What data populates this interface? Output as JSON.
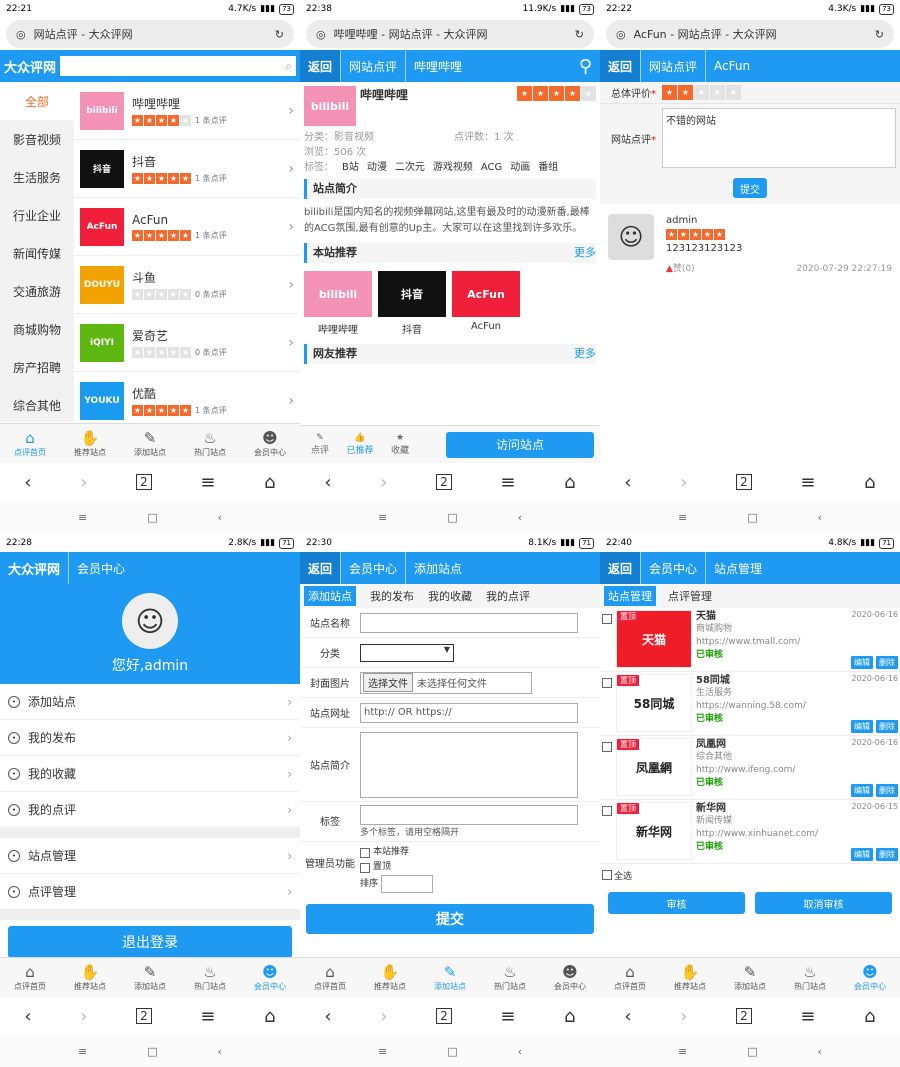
{
  "colors": {
    "blue": "#1e9af2",
    "orange": "#f56a2c",
    "green": "#18a000"
  },
  "tabs": [
    "点评首页",
    "推荐站点",
    "添加站点",
    "热门站点",
    "会员中心"
  ],
  "tab_icons": [
    "home-icon",
    "thumb-icon",
    "edit-icon",
    "flame-icon",
    "user-icon"
  ],
  "s1": {
    "time": "22:21",
    "net": "4.7K/s",
    "bat": "73",
    "url": "网站点评 - 大众评网",
    "brand": "大众评网",
    "cats": [
      "全部",
      "影音视频",
      "生活服务",
      "行业企业",
      "新闻传媒",
      "交通旅游",
      "商城购物",
      "房产招聘",
      "综合其他"
    ],
    "sites": [
      {
        "name": "哔哩哔哩",
        "rating": 4,
        "reviews": "1 条点评",
        "logo": "bilibili",
        "bg": "#f492b5"
      },
      {
        "name": "抖音",
        "rating": 5,
        "reviews": "1 条点评",
        "logo": "抖音",
        "bg": "#111111"
      },
      {
        "name": "AcFun",
        "rating": 5,
        "reviews": "1 条点评",
        "logo": "AcFun",
        "bg": "#f0203a"
      },
      {
        "name": "斗鱼",
        "rating": 0,
        "reviews": "0 条点评",
        "logo": "DOUYU",
        "bg": "#f2a300"
      },
      {
        "name": "爱奇艺",
        "rating": 0,
        "reviews": "0 条点评",
        "logo": "iQIYI",
        "bg": "#5fb812"
      },
      {
        "name": "优酷",
        "rating": 5,
        "reviews": "1 条点评",
        "logo": "YOUKU",
        "bg": "#1a9bf0"
      }
    ]
  },
  "s2": {
    "time": "22:38",
    "net": "11.9K/s",
    "bat": "73",
    "url": "哔哩哔哩 - 网站点评 - 大众评网",
    "back": "返回",
    "crumb1": "网站点评",
    "crumb2": "哔哩哔哩",
    "title": "哔哩哔哩",
    "rating": 4,
    "logo": "bilibili",
    "cat": "分类：影音视频",
    "count": "点评数：1 次",
    "views": "浏览：506 次",
    "tags_label": "标签：",
    "tags": [
      "B站",
      "动漫",
      "二次元",
      "游戏视频",
      "ACG",
      "动画",
      "番组"
    ],
    "intro_title": "站点简介",
    "intro": "bilibili是国内知名的视频弹幕网站,这里有最及时的动漫新番,最棒的ACG氛围,最有创意的Up主。大家可以在这里找到许多欢乐。",
    "rec_title": "本站推荐",
    "more": "更多",
    "recs": [
      {
        "name": "哔哩哔哩",
        "logo": "bilibili",
        "bg": "#f492b5"
      },
      {
        "name": "抖音",
        "logo": "抖音",
        "bg": "#111111"
      },
      {
        "name": "AcFun",
        "logo": "AcFun",
        "bg": "#f0203a"
      }
    ],
    "friend_title": "网友推荐",
    "actions": [
      "点评",
      "已推荐",
      "收藏"
    ],
    "visit": "访问站点"
  },
  "s3": {
    "time": "22:22",
    "net": "4.3K/s",
    "bat": "73",
    "url": "AcFun - 网站点评 - 大众评网",
    "back": "返回",
    "crumb1": "网站点评",
    "crumb2": "AcFun",
    "overall_label": "总体评价",
    "overall": 2,
    "review_label": "网站点评",
    "review_text": "不错的网站",
    "submit": "提交",
    "user": "admin",
    "user_rating": 5,
    "comment": "123123123123",
    "likes": "赞(0)",
    "date": "2020-07-29 22:27:19"
  },
  "s4": {
    "time": "22:28",
    "net": "2.8K/s",
    "bat": "71",
    "brand": "大众评网",
    "crumb": "会员中心",
    "greeting": "您好,admin",
    "menu1": [
      "添加站点",
      "我的发布",
      "我的收藏",
      "我的点评"
    ],
    "menu2": [
      "站点管理",
      "点评管理"
    ],
    "logout": "退出登录"
  },
  "s5": {
    "time": "22:30",
    "net": "8.1K/s",
    "bat": "71",
    "back": "返回",
    "crumb1": "会员中心",
    "crumb2": "添加站点",
    "tabs": [
      "添加站点",
      "我的发布",
      "我的收藏",
      "我的点评"
    ],
    "f_name": "站点名称",
    "f_cat": "分类",
    "f_cover": "封面图片",
    "file_btn": "选择文件",
    "file_none": "未选择任何文件",
    "f_url": "站点网址",
    "url_ph": "http:// OR https://",
    "f_intro": "站点简介",
    "f_tags": "标签",
    "tags_hint": "多个标签，请用空格隔开",
    "f_admin": "管理员功能",
    "chk1": "本站推荐",
    "chk2": "置顶",
    "order": "排序",
    "submit": "提交"
  },
  "s6": {
    "time": "22:40",
    "net": "4.8K/s",
    "bat": "71",
    "back": "返回",
    "crumb1": "会员中心",
    "crumb2": "站点管理",
    "tabs": [
      "站点管理",
      "点评管理"
    ],
    "pin": "置顶",
    "status": "已审核",
    "edit": "编辑",
    "del": "删除",
    "select_all": "全选",
    "approve": "审核",
    "unapprove": "取消审核",
    "sites": [
      {
        "name": "天猫",
        "cat": "商城购物",
        "url": "https://www.tmall.com/",
        "date": "2020-06-16",
        "logo": "天猫",
        "bg": "#ef1d27"
      },
      {
        "name": "58同城",
        "cat": "生活服务",
        "url": "https://wanning.58.com/",
        "date": "2020-06-16",
        "logo": "58同城",
        "bg": "#ffffff"
      },
      {
        "name": "凤凰网",
        "cat": "综合其他",
        "url": "http://www.ifeng.com/",
        "date": "2020-06-16",
        "logo": "凤凰網",
        "bg": "#ffffff"
      },
      {
        "name": "新华网",
        "cat": "新闻传媒",
        "url": "http://www.xinhuanet.com/",
        "date": "2020-06-15",
        "logo": "新华网",
        "bg": "#ffffff"
      }
    ]
  }
}
